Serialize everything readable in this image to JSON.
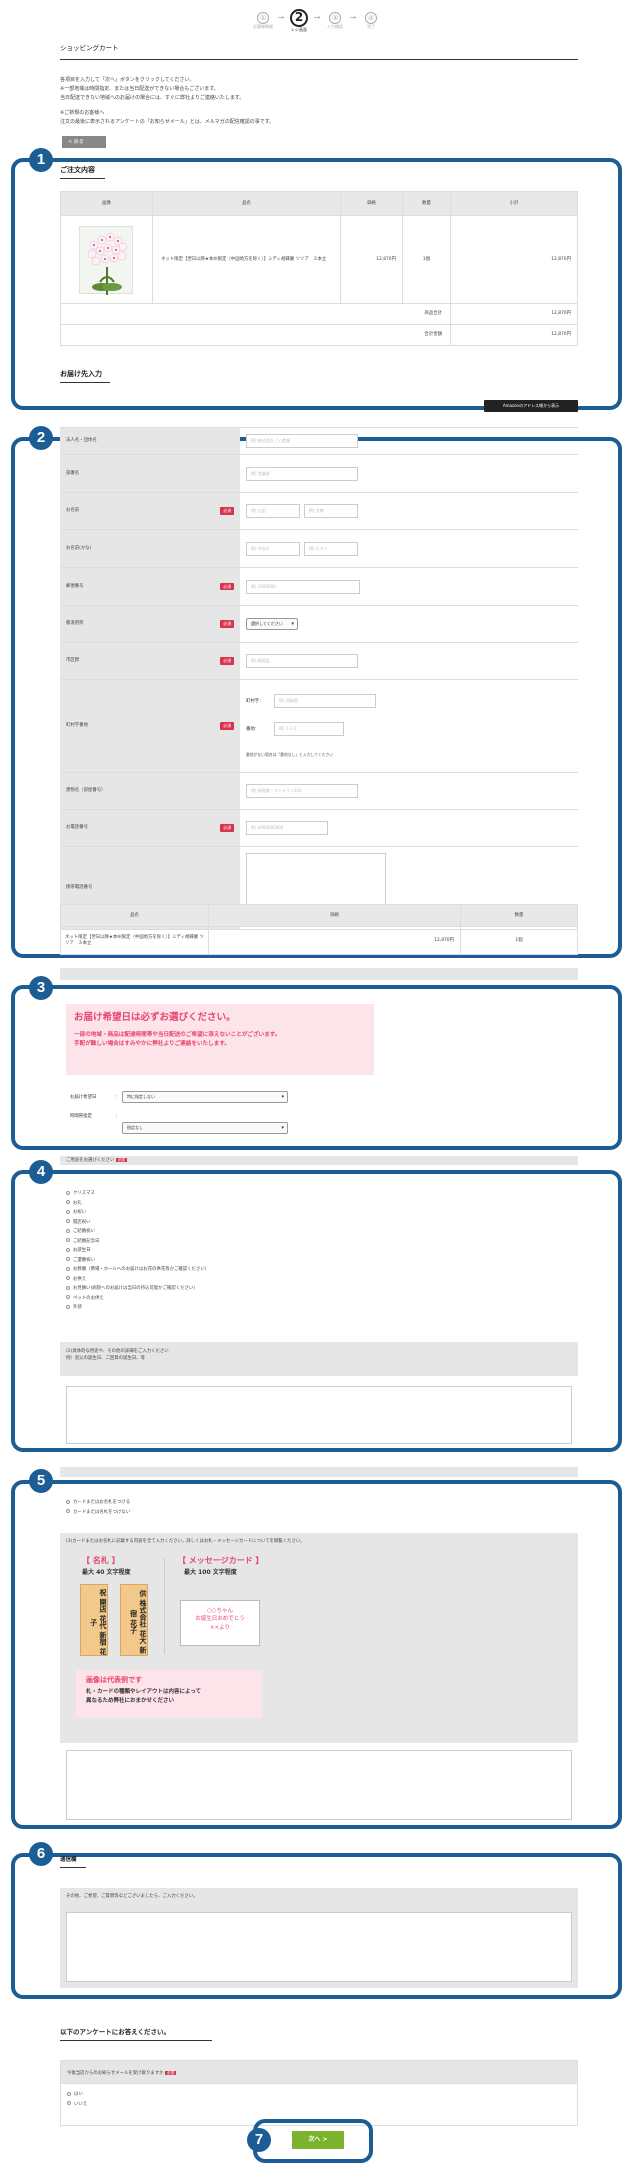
{
  "steps": [
    {
      "num": "①",
      "label": "お客様情報"
    },
    {
      "num": "②",
      "label": "レジ画面"
    },
    {
      "num": "③",
      "label": "入力確認"
    },
    {
      "num": "④",
      "label": "完了"
    }
  ],
  "page_title": "ショッピングカート",
  "intro_lines": [
    "各項目を入力して「次へ」ボタンをクリックしてください。",
    "※一部地域は時間指定、または当日配送ができない場合もございます。",
    "当日配送できない地域へのお届けの場合には、すぐに弊社よりご連絡いたします。"
  ],
  "intro_lines2": [
    "※ご新規のお客様へ",
    "注文の最後に表示されるアンケートの「お知らせメール」とは、メルマガの配信確認の事です。"
  ],
  "back_label": "<  戻る",
  "badges": [
    "1",
    "2",
    "3",
    "4",
    "5",
    "6",
    "7"
  ],
  "order": {
    "title": "ご注文内容",
    "headers": [
      "画像",
      "品名",
      "価格",
      "数量",
      "小計"
    ],
    "item_name": "ネット限定【翌日以降★本州限定（中国地方を除く）】ミディ胡蝶蘭 ツリア　３本立",
    "price": "12,870円",
    "qty": "1個",
    "subtotal": "12,870円",
    "total_label": "商品合計",
    "total_value": "12,870円",
    "sum_label": "合計金額",
    "sum_value": "12,870円"
  },
  "delivery": {
    "title": "お届け先入力",
    "amazon_btn": "Amazonのアドレス帳から表示",
    "rows": [
      {
        "label": "法人名・団体名",
        "ph": "例) 株式会社 ○○産業"
      },
      {
        "label": "部署名",
        "ph": "例) 営業部"
      },
      {
        "label": "お名前",
        "req": "必須",
        "ph1": "例) 山田",
        "ph2": "例) 太郎"
      },
      {
        "label": "お名前(かな)",
        "ph1": "例) やまだ",
        "ph2": "例) たろう"
      },
      {
        "label": "郵便番号",
        "req": "必須",
        "ph": "例) 1000000"
      },
      {
        "label": "都道府県",
        "req": "必須",
        "sel": "選択してください"
      },
      {
        "label": "市区郡",
        "req": "必須",
        "ph": "例) 新宿区"
      },
      {
        "label": "町村字番地",
        "req": "必須",
        "sub1": "町村字：",
        "ph1": "例) 西新宿",
        "sub2": "番地：",
        "ph2": "例) 1-1-1",
        "note": "番地がない場合は「番地なし」と入力してください"
      },
      {
        "label": "建物名（部屋番号）",
        "ph": "例) 新宿第一マンション204"
      },
      {
        "label": "お電話番号",
        "req": "必須",
        "ph": "例) 0000000000"
      },
      {
        "label": "携帯電話番号"
      }
    ],
    "table_headers": [
      "品名",
      "価格",
      "数量"
    ],
    "item_name": "ネット限定【翌日以降★本州限定（中国地方を除く）】ミディ胡蝶蘭 ツリア　３本立",
    "price": "12,870円",
    "qty": "1個"
  },
  "date_section": {
    "banner_title": "お届け希望日は必ずお選びください。",
    "banner_body1": "一部の地域・商品は配達時間帯や当日配送のご希望に添えないことがございます。",
    "banner_body2": "手配が難しい場合はすみやかに弊社よりご連絡をいたします。",
    "date_label": "お届け希望日",
    "date_value": "特に指定しない",
    "time_label": "時間帯指定",
    "time_value": "指定なし"
  },
  "purpose": {
    "header": "ご用途をお選びください",
    "req": "必須",
    "options": [
      "クリスマス",
      "お礼",
      "お祝い",
      "開店祝い",
      "ご結婚祝い",
      "ご結婚記念日",
      "お誕生日",
      "ご還暦祝い",
      "お葬儀（斎場・ホールへのお届けはお花の供花等かご確認ください）",
      "お供え",
      "お見舞い(病院へのお届けは当日の持込可能かご確認ください)",
      "ペットのお供え",
      "外部"
    ],
    "note_header": "(2)具体的な用途や、その他の詳細をご入力ください",
    "note_example": "例）叔父の誕生日、二回目の誕生日、等"
  },
  "card": {
    "opt1": "カードまたはお名札をつける",
    "opt2": "カードまたは名札をつけない",
    "instr": "(3)カードまたはお名札に記載する内容を全て入力ください。詳しくはお札・メッセージカードについてを御覧ください。",
    "name_tag_title": "【 名札 】",
    "name_tag_limit": "最大 40 文字程度",
    "msg_title": "【 メッセージカード 】",
    "msg_limit": "最大 100 文字程度",
    "tag1": "祝 開店 花代 新宿 花子",
    "tag2": "供 株式会社 花大 新宿 花子",
    "msg_line1": "○○ちゃん",
    "msg_line2": "お誕生日おめでとう",
    "msg_line3": "××より",
    "notice_title": "画像は代表例です",
    "notice_body1": "札・カードの種類やレイアウトは内容によって",
    "notice_body2": "異なるため弊社におまかせください"
  },
  "comment": {
    "title": "通信欄",
    "instr": "その他、ご希望、ご質問等などございましたら、ご入力ください。"
  },
  "survey": {
    "title": "以下のアンケートにお答えください。",
    "question": "今後当店からのお知らせメールを受け取りますか",
    "req": "必須",
    "yes": "はい",
    "no": "いいえ"
  },
  "next_label": "次へ  >"
}
